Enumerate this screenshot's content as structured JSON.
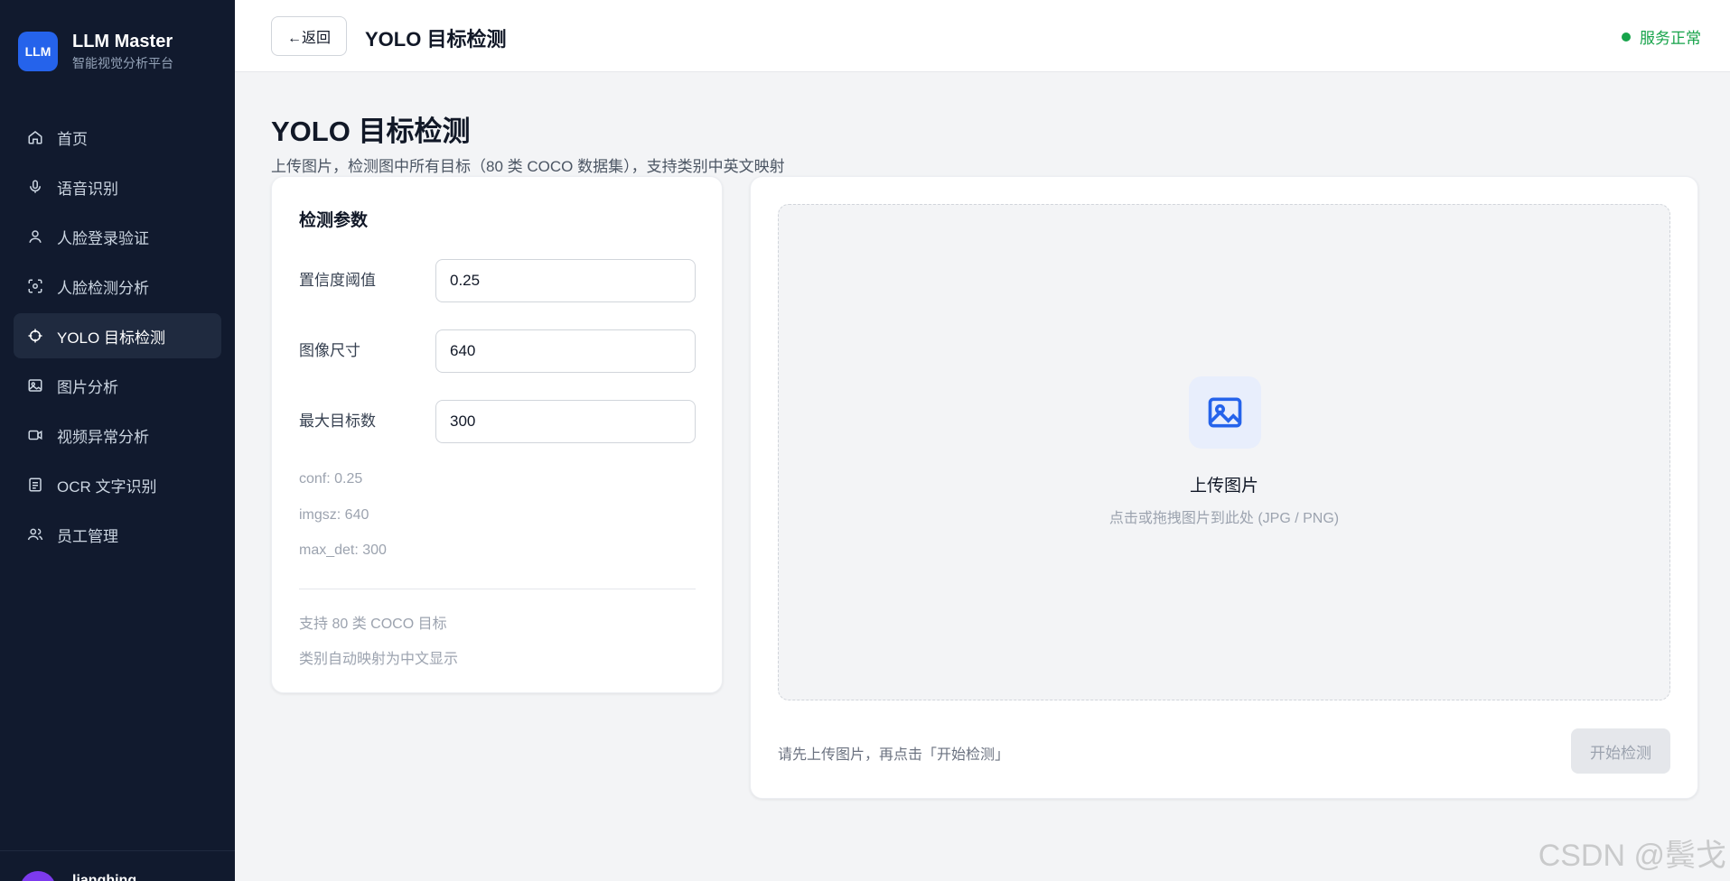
{
  "brand": {
    "logo": "LLM",
    "title": "LLM Master",
    "subtitle": "智能视觉分析平台"
  },
  "sidebar": {
    "items": [
      {
        "label": "首页",
        "icon": "home-icon"
      },
      {
        "label": "语音识别",
        "icon": "microphone-icon"
      },
      {
        "label": "人脸登录验证",
        "icon": "user-icon"
      },
      {
        "label": "人脸检测分析",
        "icon": "face-scan-icon"
      },
      {
        "label": "YOLO 目标检测",
        "icon": "crosshair-icon",
        "active": true
      },
      {
        "label": "图片分析",
        "icon": "image-icon"
      },
      {
        "label": "视频异常分析",
        "icon": "video-icon"
      },
      {
        "label": "OCR 文字识别",
        "icon": "document-icon"
      },
      {
        "label": "员工管理",
        "icon": "users-icon"
      }
    ],
    "user": {
      "name": "lianghing"
    }
  },
  "topbar": {
    "back_label": "←返回",
    "title": "YOLO 目标检测",
    "status": "服务正常",
    "status_color": "#16a34a"
  },
  "page": {
    "title": "YOLO 目标检测",
    "subtitle": "上传图片，检测图中所有目标（80 类 COCO 数据集），支持类别中英文映射"
  },
  "params": {
    "heading": "检测参数",
    "fields": [
      {
        "label": "置信度阈值",
        "value": "0.25"
      },
      {
        "label": "图像尺寸",
        "value": "640"
      },
      {
        "label": "最大目标数",
        "value": "300"
      }
    ],
    "summary": [
      "conf: 0.25",
      "imgsz: 640",
      "max_det: 300"
    ],
    "notes": [
      "支持 80 类 COCO 目标",
      "类别自动映射为中文显示"
    ]
  },
  "upload": {
    "title": "上传图片",
    "subtitle": "点击或拖拽图片到此处 (JPG / PNG)",
    "hint": "请先上传图片，再点击「开始检测」",
    "start_label": "开始检测",
    "accent": "#2563eb"
  },
  "watermark": "CSDN @鬓戈"
}
